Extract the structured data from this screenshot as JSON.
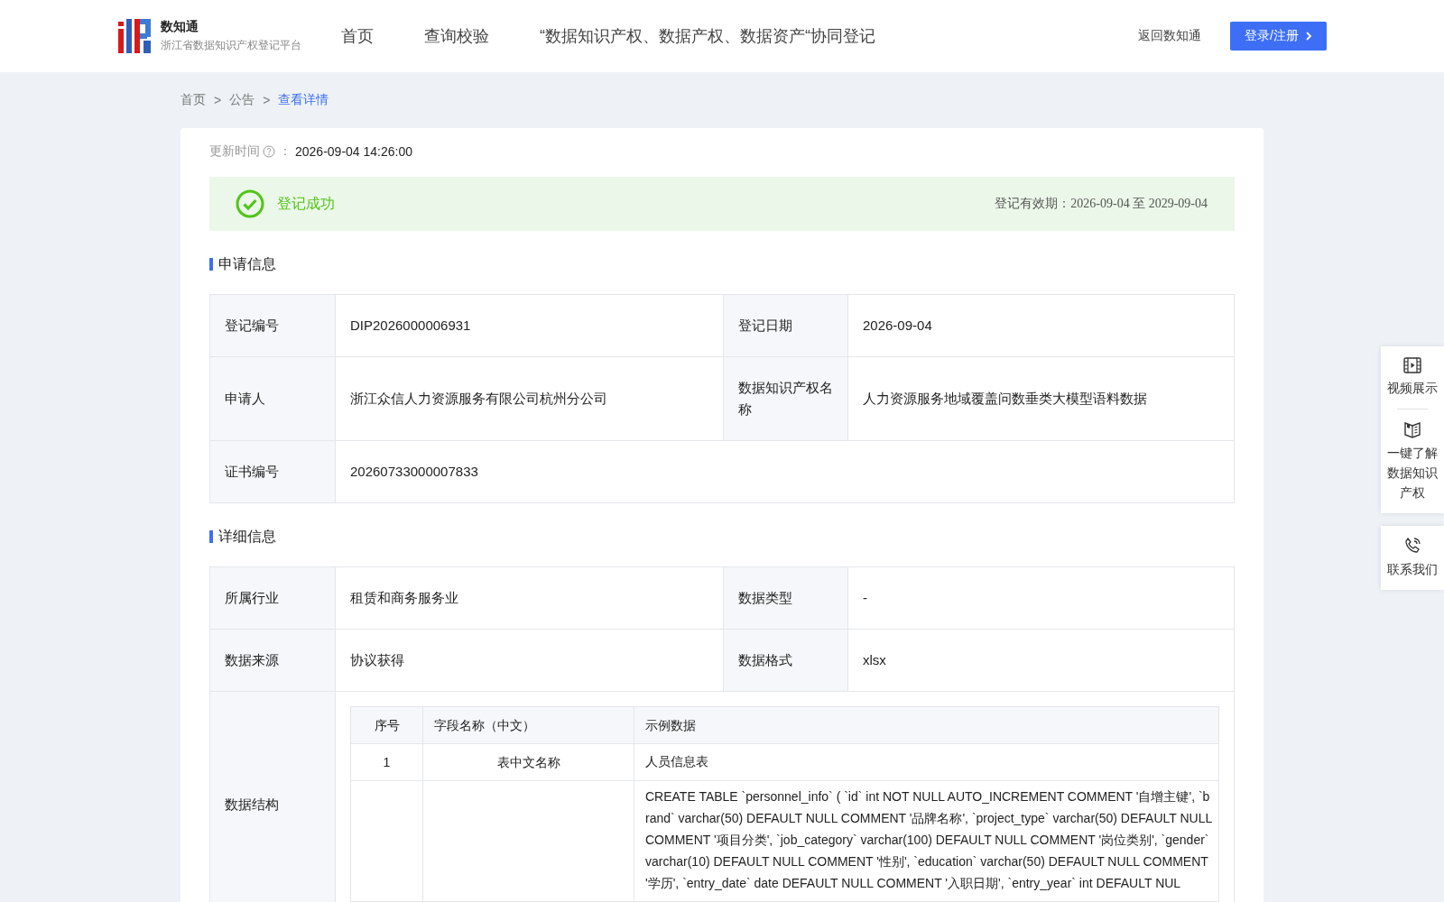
{
  "header": {
    "logo_title": "数知通",
    "logo_subtitle": "浙江省数据知识产权登记平台",
    "nav": [
      {
        "label": "首页",
        "selected": false
      },
      {
        "label": "查询校验",
        "selected": false
      },
      {
        "label": "“数据知识产权、数据产权、数据资产“协同登记",
        "selected": false
      }
    ],
    "back_link": "返回数知通",
    "login_button": "登录/注册"
  },
  "breadcrumb": {
    "items": [
      {
        "label": "首页",
        "current": false
      },
      {
        "label": "公告",
        "current": false
      },
      {
        "label": "查看详情",
        "current": true
      }
    ],
    "separators": [
      ">",
      ">"
    ]
  },
  "update": {
    "label": "更新时间",
    "separator": "：",
    "value": "2026-09-04 14:26:00"
  },
  "status": {
    "kind": "success",
    "text": "登记成功",
    "validity": "登记有效期：2026-09-04 至 2029-09-04"
  },
  "application_section": {
    "title": "申请信息",
    "rows": [
      [
        {
          "label": "登记编号",
          "value": "DIP2026000006931"
        },
        {
          "label": "登记日期",
          "value": "2026-09-04"
        }
      ],
      [
        {
          "label": "申请人",
          "value": "浙江众信人力资源服务有限公司杭州分公司"
        },
        {
          "label": "数据知识产权名称",
          "value": "人力资源服务地域覆盖问数垂类大模型语料数据"
        }
      ],
      [
        {
          "label": "证书编号",
          "value": "20260733000007833"
        }
      ]
    ]
  },
  "detail_section": {
    "title": "详细信息",
    "rows": [
      [
        {
          "label": "所属行业",
          "value": "租赁和商务服务业"
        },
        {
          "label": "数据类型",
          "value": "-"
        }
      ],
      [
        {
          "label": "数据来源",
          "value": "协议获得"
        },
        {
          "label": "数据格式",
          "value": "xlsx"
        }
      ]
    ],
    "structure": {
      "label": "数据结构",
      "columns": [
        "序号",
        "字段名称（中文）",
        "示例数据"
      ],
      "rows": [
        {
          "index": "1",
          "field": "表中文名称",
          "example": "人员信息表"
        },
        {
          "example": "CREATE TABLE `personnel_info` ( `id` int NOT NULL AUTO_INCREMENT COMMENT '自增主键', `brand` varchar(50) DEFAULT NULL COMMENT '品牌名称', `project_type` varchar(50) DEFAULT NULL COMMENT '项目分类', `job_category` varchar(100) DEFAULT NULL COMMENT '岗位类别', `gender` varchar(10) DEFAULT NULL COMMENT '性别', `education` varchar(50) DEFAULT NULL COMMENT '学历', `entry_date` date DEFAULT NULL COMMENT '入职日期', `entry_year` int DEFAULT NUL"
        }
      ]
    }
  },
  "side_panels": [
    {
      "items": [
        {
          "kind": "video",
          "label": "视频展示"
        },
        {
          "kind": "guide",
          "label": "一键了解数据知识产权"
        }
      ]
    },
    {
      "items": [
        {
          "kind": "phone",
          "label": "联系我们"
        }
      ]
    }
  ]
}
